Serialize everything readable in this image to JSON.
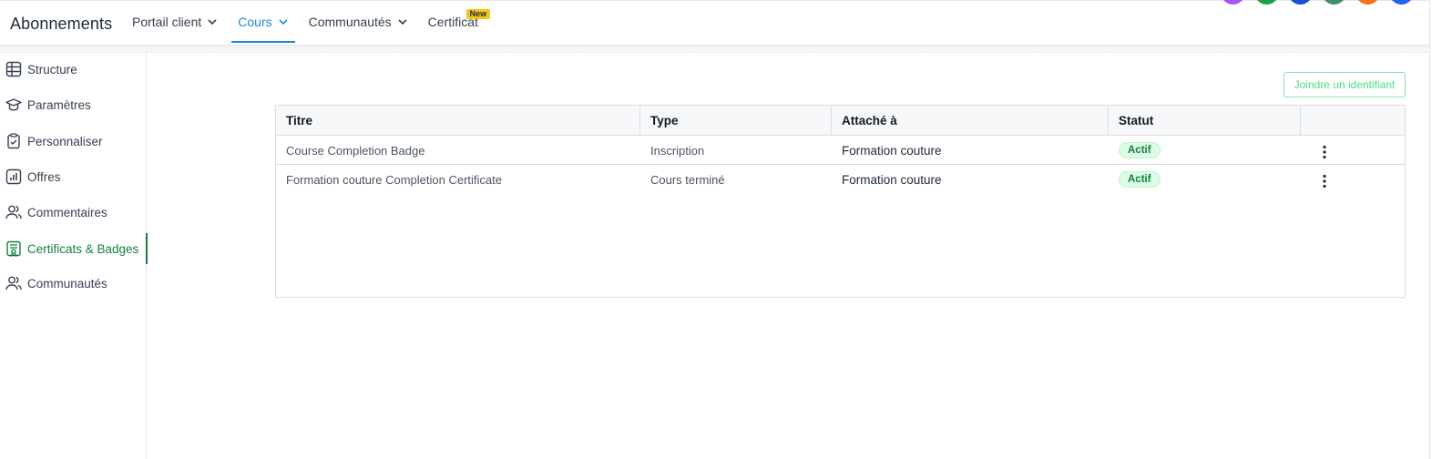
{
  "header": {
    "app_title": "Abonnements",
    "nav": [
      {
        "label": "Portail client",
        "has_chevron": true
      },
      {
        "label": "Cours",
        "has_chevron": true,
        "active": true
      },
      {
        "label": "Communautés",
        "has_chevron": true
      },
      {
        "label": "Certificat",
        "badge": "New"
      }
    ],
    "avatar_colors": [
      "#a855f7",
      "#16a34a",
      "#1d4ed8",
      "#3f8f6b",
      "#f97316",
      "#2563eb"
    ]
  },
  "sidebar": {
    "items": [
      {
        "label": "Structure",
        "icon": "table-grid-icon"
      },
      {
        "label": "Paramètres",
        "icon": "graduation-cap-icon"
      },
      {
        "label": "Personnaliser",
        "icon": "clipboard-check-icon"
      },
      {
        "label": "Offres",
        "icon": "bar-chart-icon"
      },
      {
        "label": "Commentaires",
        "icon": "users-icon"
      },
      {
        "label": "Certificats & Badges",
        "icon": "certificate-icon",
        "active": true
      },
      {
        "label": "Communautés",
        "icon": "users-icon"
      }
    ]
  },
  "main": {
    "join_button": "Joindre un identifiant",
    "table": {
      "headers": [
        "Titre",
        "Type",
        "Attaché à",
        "Statut",
        ""
      ],
      "rows": [
        {
          "title": "Course Completion Badge",
          "type": "Inscription",
          "attached": "Formation couture",
          "status": "Actif"
        },
        {
          "title": "Formation couture Completion Certificate",
          "type": "Cours terminé",
          "attached": "Formation couture",
          "status": "Actif"
        }
      ]
    }
  },
  "colors": {
    "accent_blue": "#1e88d2",
    "accent_green": "#15803d",
    "new_badge": "#f5c518"
  }
}
